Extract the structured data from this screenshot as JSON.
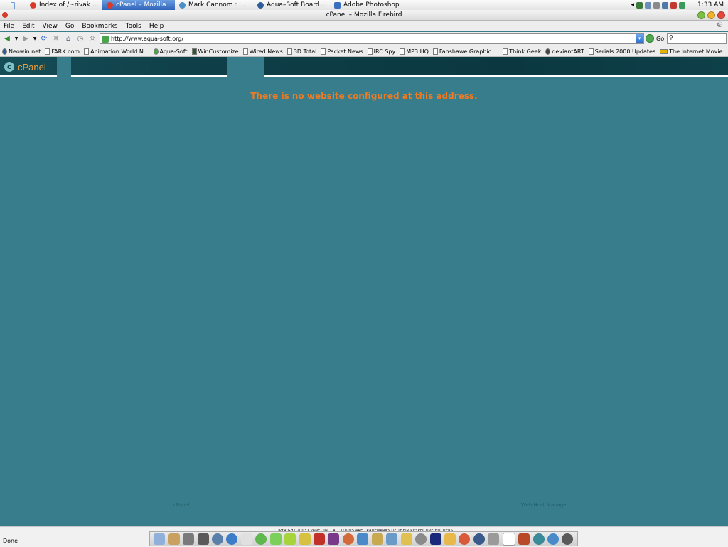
{
  "taskbar": {
    "tasks": [
      {
        "label": "Index of /~rivak ...",
        "color": "#d9392b",
        "active": false
      },
      {
        "label": "cPanel – Mozilla ...",
        "color": "#d9392b",
        "active": true
      },
      {
        "label": "Mark Cannom : ...",
        "color": "#4a8fc9",
        "active": false
      },
      {
        "label": "Aqua–Soft Board...",
        "color": "#2d5d9a",
        "active": false
      },
      {
        "label": "Adobe Photoshop",
        "color": "#3a6fc0",
        "active": false
      }
    ],
    "clock": "1:33 AM"
  },
  "window": {
    "title": "cPanel – Mozilla Firebird"
  },
  "menu": [
    "File",
    "Edit",
    "View",
    "Go",
    "Bookmarks",
    "Tools",
    "Help"
  ],
  "nav": {
    "url": "http://www.aqua-soft.org/",
    "go_label": "Go"
  },
  "bookmarks": [
    "Neowin.net",
    "FARK.com",
    "Animation World N...",
    "Aqua-Soft",
    "WinCustomize",
    "Wired News",
    "3D Total",
    "Packet News",
    "IRC Spy",
    "MP3 HQ",
    "Fanshawe Graphic ...",
    "Think Geek",
    "deviantART",
    "Serials 2000 Updates",
    "The Internet Movie ..."
  ],
  "cpanel": {
    "logo": "cPanel",
    "message": "There is no website configured at this address.",
    "footer_left": "cPanel",
    "footer_right": "Web Host Manager",
    "copyright": "COPYRIGHT 2003 CPANEL INC. ALL LOGOS ARE TRADEMARKS OF THEIR RESPECTIVE HOLDERS."
  },
  "status": "Done",
  "colors": {
    "page_bg": "#377d8b",
    "header_bg": "#0d3f47",
    "message": "#f07a22",
    "logo": "#f0a13a"
  }
}
